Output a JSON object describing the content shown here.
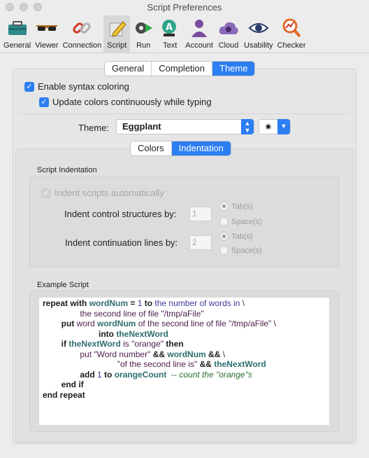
{
  "window": {
    "title": "Script Preferences"
  },
  "toolbar": {
    "items": [
      {
        "label": "General",
        "icon": "toolbox-icon"
      },
      {
        "label": "Viewer",
        "icon": "glasses-icon"
      },
      {
        "label": "Connection",
        "icon": "link-icon"
      },
      {
        "label": "Script",
        "icon": "pencil-icon"
      },
      {
        "label": "Run",
        "icon": "gear-run-icon"
      },
      {
        "label": "Text",
        "icon": "text-icon"
      },
      {
        "label": "Account",
        "icon": "account-icon"
      },
      {
        "label": "Cloud",
        "icon": "cloud-icon"
      },
      {
        "label": "Usability",
        "icon": "eye-icon"
      },
      {
        "label": "Checker",
        "icon": "magnifier-icon"
      }
    ],
    "selected": "Script"
  },
  "tabs": {
    "items": [
      "General",
      "Completion",
      "Theme"
    ],
    "selected": "Theme"
  },
  "syntax": {
    "enable_label": "Enable syntax coloring",
    "enable_checked": true,
    "update_label": "Update colors continuously while typing",
    "update_checked": true
  },
  "theme": {
    "label": "Theme:",
    "value": "Eggplant",
    "options_icon": "gear-icon"
  },
  "subtabs": {
    "items": [
      "Colors",
      "Indentation"
    ],
    "selected": "Indentation"
  },
  "indentation": {
    "section_title": "Script Indentation",
    "auto_label": "Indent scripts automatically",
    "auto_checked": true,
    "control_label": "Indent control structures by:",
    "control_value": "1",
    "continuation_label": "Indent continuation lines by:",
    "continuation_value": "2",
    "radio_tab": "Tab(s)",
    "radio_space": "Space(s)"
  },
  "example": {
    "section_title": "Example Script",
    "lines": [
      [
        [
          "k",
          "repeat with "
        ],
        [
          "v",
          "wordNum"
        ],
        [
          "k",
          " = "
        ],
        [
          "n",
          "1"
        ],
        [
          "k",
          " to "
        ],
        [
          "n",
          "the number of words in"
        ],
        [
          "s",
          " \\"
        ]
      ],
      [
        [
          "s",
          "                the second line of file "
        ],
        [
          "s",
          "\"/tmp/aFile\""
        ]
      ],
      [
        [
          "s",
          "        "
        ],
        [
          "k",
          "put "
        ],
        [
          "s",
          "word "
        ],
        [
          "v",
          "wordNum"
        ],
        [
          "s",
          " of the second line of file "
        ],
        [
          "s",
          "\"/tmp/aFile\""
        ],
        [
          "s",
          " \\"
        ]
      ],
      [
        [
          "s",
          "                        "
        ],
        [
          "k",
          "into "
        ],
        [
          "v",
          "theNextWord"
        ]
      ],
      [
        [
          "s",
          "        "
        ],
        [
          "k",
          "if "
        ],
        [
          "v",
          "theNextWord"
        ],
        [
          "s",
          " is "
        ],
        [
          "s",
          "\"orange\""
        ],
        [
          "k",
          " then"
        ]
      ],
      [
        [
          "s",
          "                "
        ],
        [
          "s",
          "put "
        ],
        [
          "s",
          "\"Word number\""
        ],
        [
          "k",
          " && "
        ],
        [
          "v",
          "wordNum"
        ],
        [
          "k",
          " && "
        ],
        [
          "s",
          "\\"
        ]
      ],
      [
        [
          "s",
          "                                "
        ],
        [
          "s",
          "\"of the second line is\""
        ],
        [
          "k",
          " && "
        ],
        [
          "v",
          "theNextWord"
        ]
      ],
      [
        [
          "s",
          "                "
        ],
        [
          "k",
          "add "
        ],
        [
          "n",
          "1"
        ],
        [
          "k",
          " to "
        ],
        [
          "v",
          "orangeCount"
        ],
        [
          "cm",
          "  -- count the \"orange\"s"
        ]
      ],
      [
        [
          "s",
          "        "
        ],
        [
          "k",
          "end if"
        ]
      ],
      [
        [
          "k",
          "end repeat"
        ]
      ]
    ]
  }
}
